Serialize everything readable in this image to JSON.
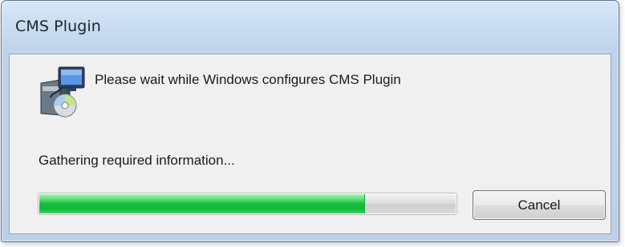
{
  "window": {
    "title": "CMS Plugin"
  },
  "dialog": {
    "icon": "installer-package-icon",
    "message": "Please wait while Windows configures CMS Plugin",
    "status": "Gathering required information...",
    "progress": 0.78,
    "cancel_label": "Cancel"
  },
  "colors": {
    "progress_fill": "#17c040",
    "client_background": "#f0f0f0",
    "titlebar": "#c6daf0"
  }
}
